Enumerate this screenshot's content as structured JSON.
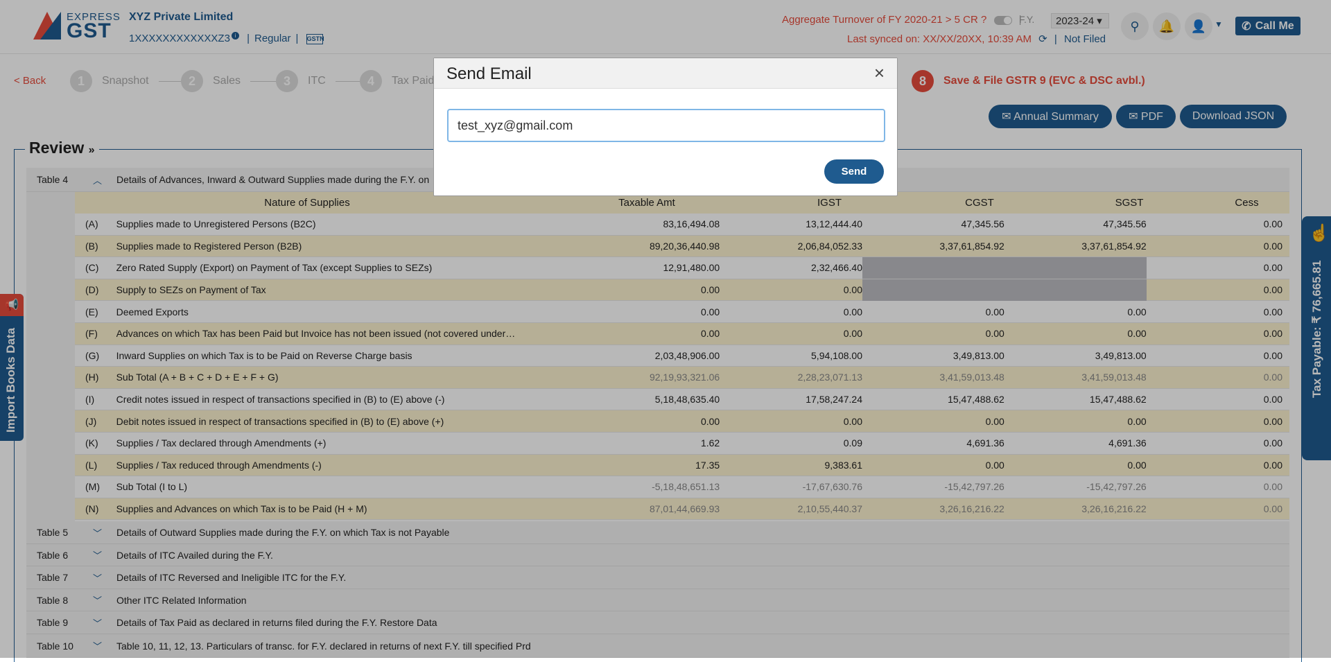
{
  "header": {
    "logo_top": "EXPRESS",
    "logo_main": "GST",
    "company": "XYZ Private Limited",
    "gstin": "1XXXXXXXXXXXXZ3",
    "gstin_info": "i",
    "reg_type": "Regular",
    "gstn_badge": "GSTN",
    "turnover_label": "Aggregate Turnover of FY 2020-21 > 5 CR ?",
    "fy_label": "F.Y.",
    "fy_value": "2023-24",
    "last_synced": "Last synced on: XX/XX/20XX, 10:39 AM",
    "filing_status": "Not Filed",
    "call_me": "Call Me"
  },
  "stepper": {
    "back": "< Back",
    "steps": [
      {
        "num": "1",
        "label": "Snapshot"
      },
      {
        "num": "2",
        "label": "Sales"
      },
      {
        "num": "3",
        "label": "ITC"
      },
      {
        "num": "4",
        "label": "Tax Paid"
      },
      {
        "num": "8",
        "label": "Save & File GSTR 9 (EVC & DSC avbl.)"
      }
    ]
  },
  "actions": {
    "annual_summary": "✉ Annual Summary",
    "pdf": "✉ PDF",
    "download_json": "Download JSON"
  },
  "review": {
    "title": "Review",
    "table4": {
      "num": "Table 4",
      "desc": "Details of Advances, Inward & Outward Supplies made during the F.Y. on",
      "headers": [
        "Nature of Supplies",
        "Taxable Amt",
        "IGST",
        "CGST",
        "SGST",
        "Cess"
      ],
      "rows": [
        {
          "code": "(A)",
          "desc": "Supplies made to Unregistered Persons (B2C)",
          "taxable": "83,16,494.08",
          "igst": "13,12,444.40",
          "cgst": "47,345.56",
          "sgst": "47,345.56",
          "cess": "0.00"
        },
        {
          "code": "(B)",
          "desc": "Supplies made to Registered Person (B2B)",
          "taxable": "89,20,36,440.98",
          "igst": "2,06,84,052.33",
          "cgst": "3,37,61,854.92",
          "sgst": "3,37,61,854.92",
          "cess": "0.00"
        },
        {
          "code": "(C)",
          "desc": "Zero Rated Supply (Export) on Payment of Tax (except Supplies to SEZs)",
          "taxable": "12,91,480.00",
          "igst": "2,32,466.40",
          "cgst": "",
          "sgst": "",
          "cess": "0.00"
        },
        {
          "code": "(D)",
          "desc": "Supply to SEZs on Payment of Tax",
          "taxable": "0.00",
          "igst": "0.00",
          "cgst": "",
          "sgst": "",
          "cess": "0.00"
        },
        {
          "code": "(E)",
          "desc": "Deemed Exports",
          "taxable": "0.00",
          "igst": "0.00",
          "cgst": "0.00",
          "sgst": "0.00",
          "cess": "0.00"
        },
        {
          "code": "(F)",
          "desc": "Advances on which Tax has been Paid but Invoice has not been issued (not covered under (...",
          "taxable": "0.00",
          "igst": "0.00",
          "cgst": "0.00",
          "sgst": "0.00",
          "cess": "0.00"
        },
        {
          "code": "(G)",
          "desc": "Inward Supplies on which Tax is to be Paid on Reverse Charge basis",
          "taxable": "2,03,48,906.00",
          "igst": "5,94,108.00",
          "cgst": "3,49,813.00",
          "sgst": "3,49,813.00",
          "cess": "0.00"
        },
        {
          "code": "(H)",
          "desc": "Sub Total (A + B + C + D + E + F + G)",
          "taxable": "92,19,93,321.06",
          "igst": "2,28,23,071.13",
          "cgst": "3,41,59,013.48",
          "sgst": "3,41,59,013.48",
          "cess": "0.00"
        },
        {
          "code": "(I)",
          "desc": "Credit notes issued in respect of transactions specified in (B) to (E) above (-)",
          "taxable": "5,18,48,635.40",
          "igst": "17,58,247.24",
          "cgst": "15,47,488.62",
          "sgst": "15,47,488.62",
          "cess": "0.00"
        },
        {
          "code": "(J)",
          "desc": "Debit notes issued in respect of transactions specified in (B) to (E) above (+)",
          "taxable": "0.00",
          "igst": "0.00",
          "cgst": "0.00",
          "sgst": "0.00",
          "cess": "0.00"
        },
        {
          "code": "(K)",
          "desc": "Supplies / Tax declared through Amendments (+)",
          "taxable": "1.62",
          "igst": "0.09",
          "cgst": "4,691.36",
          "sgst": "4,691.36",
          "cess": "0.00"
        },
        {
          "code": "(L)",
          "desc": "Supplies / Tax reduced through Amendments (-)",
          "taxable": "17.35",
          "igst": "9,383.61",
          "cgst": "0.00",
          "sgst": "0.00",
          "cess": "0.00"
        },
        {
          "code": "(M)",
          "desc": "Sub Total (I to L)",
          "taxable": "-5,18,48,651.13",
          "igst": "-17,67,630.76",
          "cgst": "-15,42,797.26",
          "sgst": "-15,42,797.26",
          "cess": "0.00"
        },
        {
          "code": "(N)",
          "desc": "Supplies and Advances on which Tax is to be Paid (H + M)",
          "taxable": "87,01,44,669.93",
          "igst": "2,10,55,440.37",
          "cgst": "3,26,16,216.22",
          "sgst": "3,26,16,216.22",
          "cess": "0.00"
        }
      ]
    },
    "other_tables": [
      {
        "num": "Table 5",
        "desc": "Details of Outward Supplies made during the F.Y. on which Tax is not Payable"
      },
      {
        "num": "Table 6",
        "desc": "Details of ITC Availed during the F.Y."
      },
      {
        "num": "Table 7",
        "desc": "Details of ITC Reversed and Ineligible ITC for the F.Y."
      },
      {
        "num": "Table 8",
        "desc": "Other ITC Related Information"
      },
      {
        "num": "Table 9",
        "desc": "Details of Tax Paid as declared in returns filed during the F.Y. Restore Data"
      },
      {
        "num": "Table 10",
        "desc": "Table 10, 11, 12, 13. Particulars of transc. for F.Y. declared in returns of next F.Y. till specified Prd"
      }
    ]
  },
  "side": {
    "import_books": "Import Books Data",
    "tax_payable": "Tax Payable: ₹ 76,665.81"
  },
  "modal": {
    "title": "Send Email",
    "close": "×",
    "email_value": "test_xyz@gmail.com",
    "send": "Send"
  },
  "colors": {
    "brand_blue": "#1f5b8f",
    "accent_red": "#e74c3c",
    "row_highlight": "#fdf3d0"
  }
}
